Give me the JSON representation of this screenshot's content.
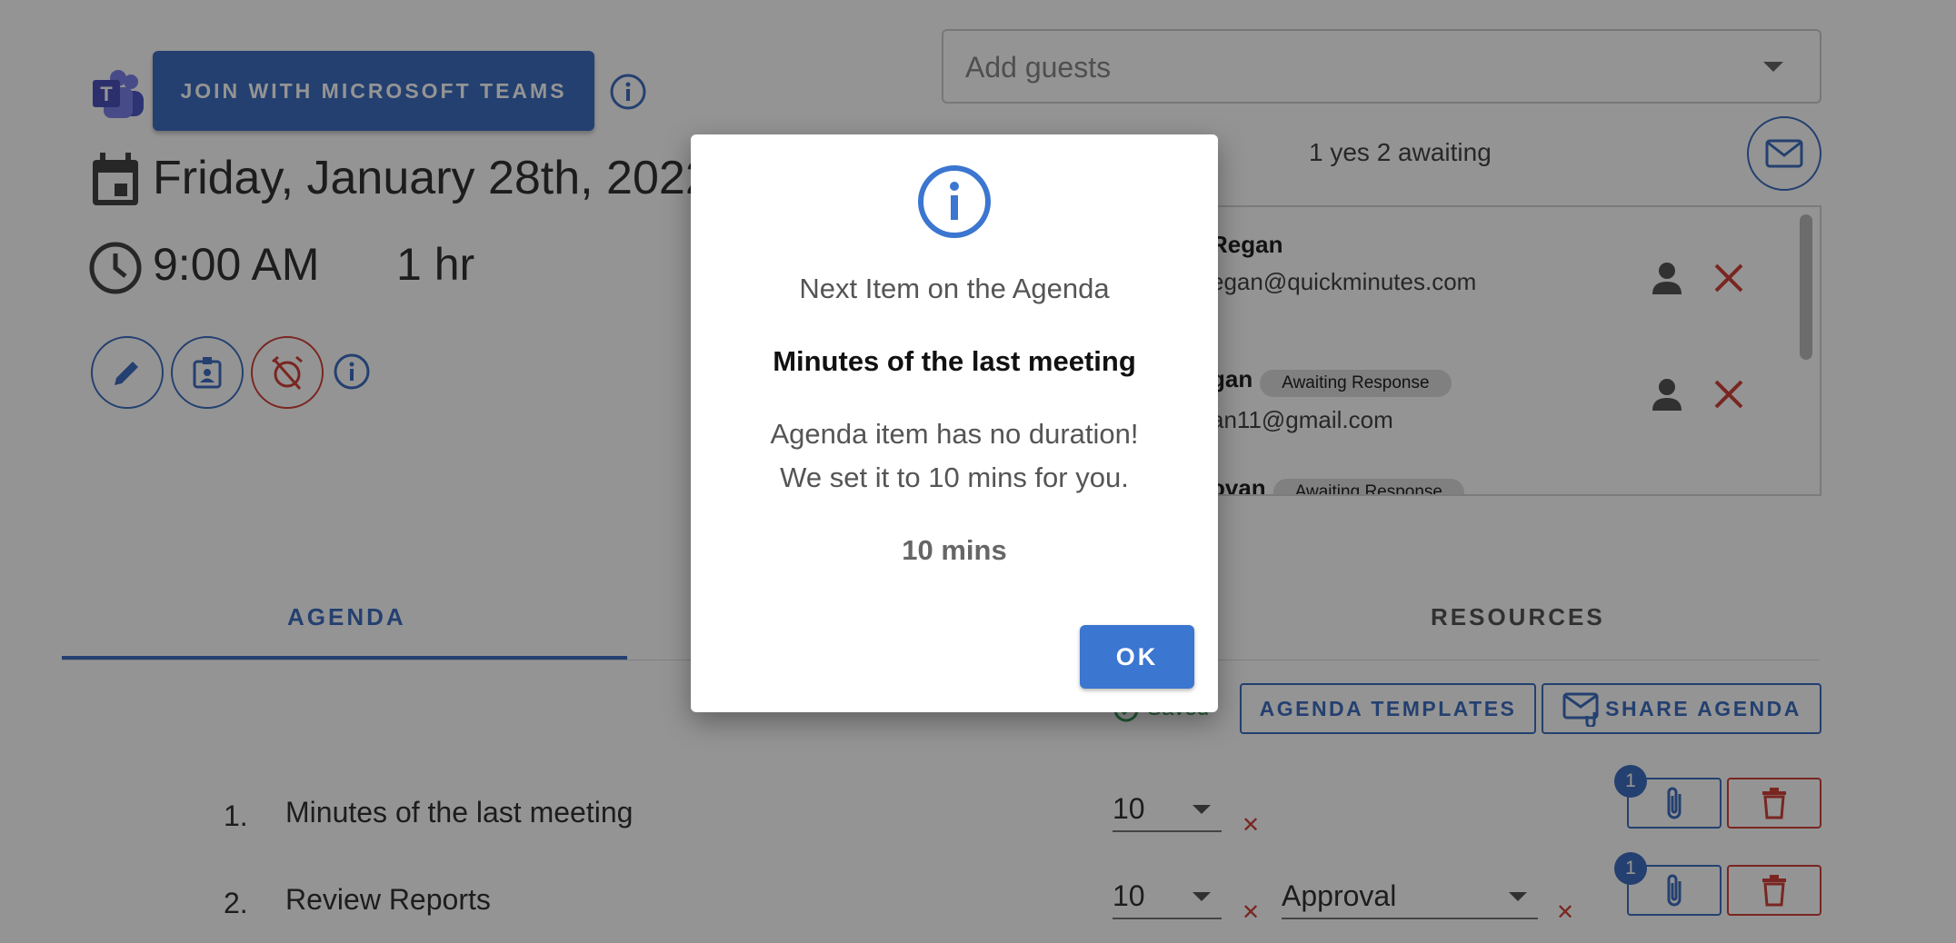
{
  "meeting": {
    "teams_button": "JOIN WITH MICROSOFT TEAMS",
    "date": "Friday, January 28th, 2022",
    "time": "9:00 AM",
    "duration": "1 hr"
  },
  "guests": {
    "placeholder": "Add guests",
    "rsvp_summary": "1 yes 2 awaiting",
    "attendees": [
      {
        "name": "Regan",
        "email": "egan@quickminutes.com",
        "status": ""
      },
      {
        "name": "gan",
        "email": "an11@gmail.com",
        "status": "Awaiting Response"
      },
      {
        "name": "ovan",
        "email": "",
        "status": "Awaiting Response"
      }
    ]
  },
  "tabs": {
    "agenda": "AGENDA",
    "resources": "RESOURCES"
  },
  "toolbar": {
    "saved": "Saved",
    "templates": "AGENDA TEMPLATES",
    "share": "SHARE AGENDA"
  },
  "agenda_items": [
    {
      "num": "1.",
      "title": "Minutes of the last meeting",
      "duration": "10",
      "type": "",
      "attachments": "1"
    },
    {
      "num": "2.",
      "title": "Review Reports",
      "duration": "10",
      "type": "Approval",
      "attachments": "1"
    }
  ],
  "dialog": {
    "heading": "Next Item on the Agenda",
    "item_title": "Minutes of the last meeting",
    "message_line1": "Agenda item has no duration!",
    "message_line2": "We set it to 10 mins for you.",
    "duration_value": "10 mins",
    "ok_label": "OK"
  },
  "colors": {
    "primary": "#3f6fc1",
    "danger": "#d0433a",
    "dialog_button": "#3b76d0"
  }
}
